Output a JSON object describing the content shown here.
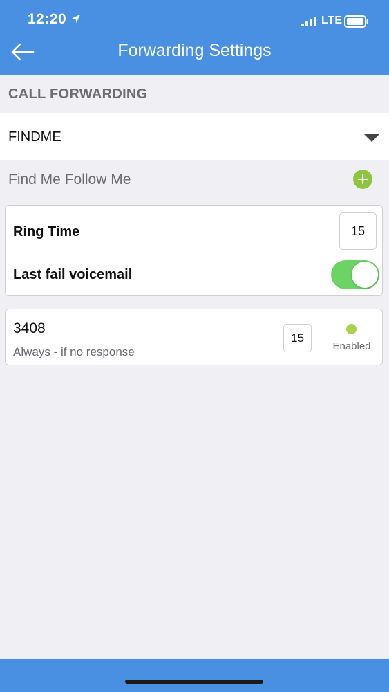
{
  "status_bar": {
    "time": "12:20",
    "network": "LTE",
    "icons": [
      "location-arrow-icon",
      "signal-bars-icon",
      "battery-icon"
    ]
  },
  "header": {
    "title": "Forwarding Settings",
    "back_icon": "arrow-left-icon",
    "background_color": "#4a90e2"
  },
  "section": {
    "title": "CALL FORWARDING"
  },
  "dropdown": {
    "selected": "FINDME",
    "icon": "caret-down-icon"
  },
  "find_me": {
    "label": "Find Me Follow Me",
    "add_icon": "plus-circle-icon",
    "accent_color": "#8cc63f"
  },
  "settings": {
    "ring_time_label": "Ring Time",
    "ring_time_value": "15",
    "voicemail_label": "Last fail voicemail",
    "voicemail_enabled": true,
    "toggle_color": "#6cd464"
  },
  "entries": [
    {
      "number": "3408",
      "description": "Always - if no response",
      "ring_time": "15",
      "status": "Enabled",
      "status_color": "#a8d44a"
    }
  ]
}
